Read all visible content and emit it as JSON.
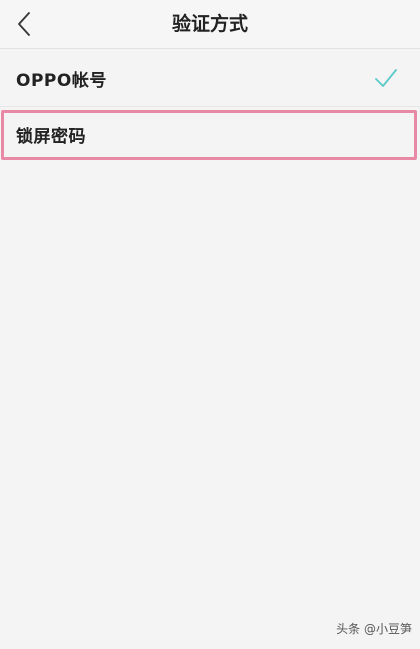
{
  "header": {
    "title": "验证方式",
    "back_icon": "chevron-left-icon"
  },
  "options": [
    {
      "label": "OPPO帐号",
      "selected": true,
      "icon": "checkmark-icon"
    },
    {
      "label": "锁屏密码",
      "selected": false
    }
  ],
  "colors": {
    "check": "#5bc9c9",
    "highlight_border": "#e889a6"
  },
  "watermark": "头条 @小豆笋"
}
